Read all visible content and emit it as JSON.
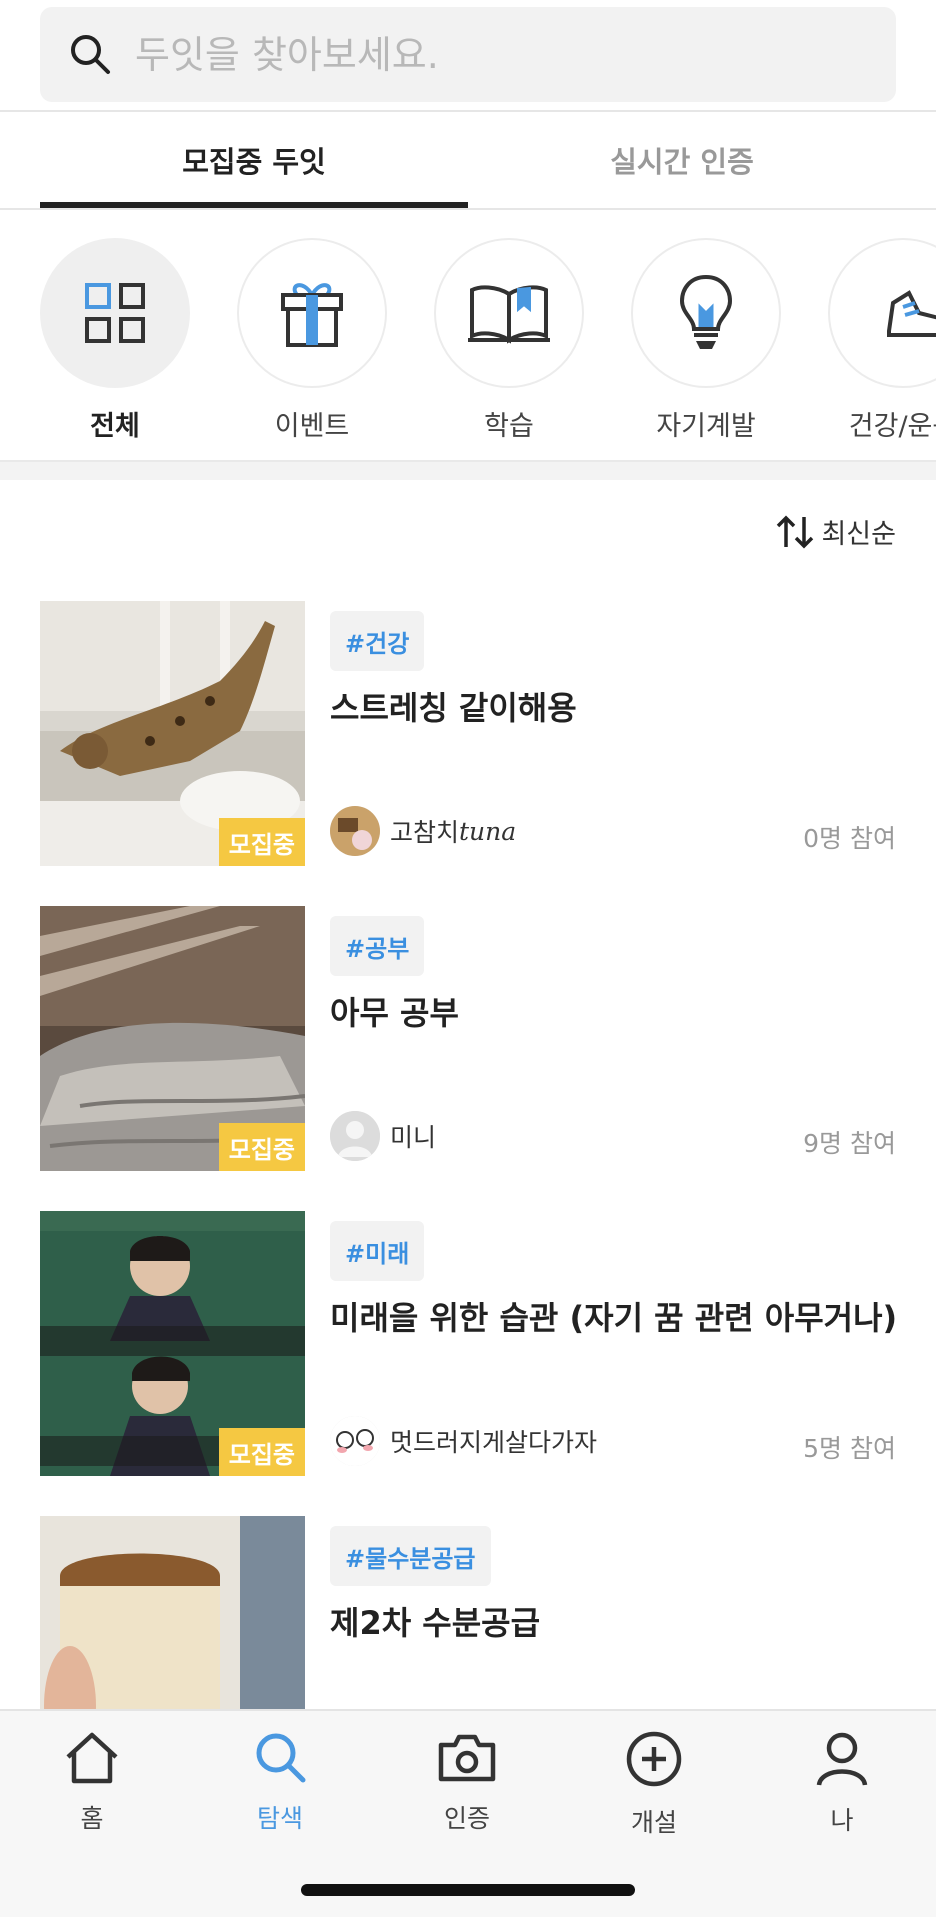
{
  "search": {
    "placeholder": "두잇을 찾아보세요."
  },
  "tabs": [
    {
      "label": "모집중 두잇",
      "active": true
    },
    {
      "label": "실시간 인증",
      "active": false
    }
  ],
  "categories": [
    {
      "label": "전체",
      "icon": "grid-icon",
      "selected": true
    },
    {
      "label": "이벤트",
      "icon": "gift-icon",
      "selected": false
    },
    {
      "label": "학습",
      "icon": "book-icon",
      "selected": false
    },
    {
      "label": "자기계발",
      "icon": "lightbulb-icon",
      "selected": false
    },
    {
      "label": "건강/운동",
      "icon": "sneaker-icon",
      "selected": false
    }
  ],
  "sort": {
    "label": "최신순",
    "icon": "sort-icon"
  },
  "items": [
    {
      "tag": "#건강",
      "title": "스트레칭 같이해용",
      "author": "고참치",
      "author_suffix": "tuna",
      "count": "0명 참여",
      "badge": "모집중"
    },
    {
      "tag": "#공부",
      "title": "아무 공부",
      "author": "미니",
      "author_suffix": "",
      "count": "9명 참여",
      "badge": "모집중"
    },
    {
      "tag": "#미래",
      "title": "미래을 위한 습관 (자기 꿈 관련 아무거나)",
      "author": "멋드러지게살다가자",
      "author_suffix": "",
      "count": "5명 참여",
      "badge": "모집중"
    },
    {
      "tag": "#물수분공급",
      "title": "제2차 수분공급",
      "author": "",
      "author_suffix": "",
      "count": "",
      "badge": ""
    }
  ],
  "nav": [
    {
      "label": "홈",
      "icon": "home-icon",
      "active": false
    },
    {
      "label": "탐색",
      "icon": "search-icon",
      "active": true
    },
    {
      "label": "인증",
      "icon": "camera-icon",
      "active": false
    },
    {
      "label": "개설",
      "icon": "plus-circle-icon",
      "active": false
    },
    {
      "label": "나",
      "icon": "person-icon",
      "active": false
    }
  ],
  "colors": {
    "accent": "#4a98e0",
    "badge": "#f5c842",
    "tag_text": "#3a8fe0"
  }
}
